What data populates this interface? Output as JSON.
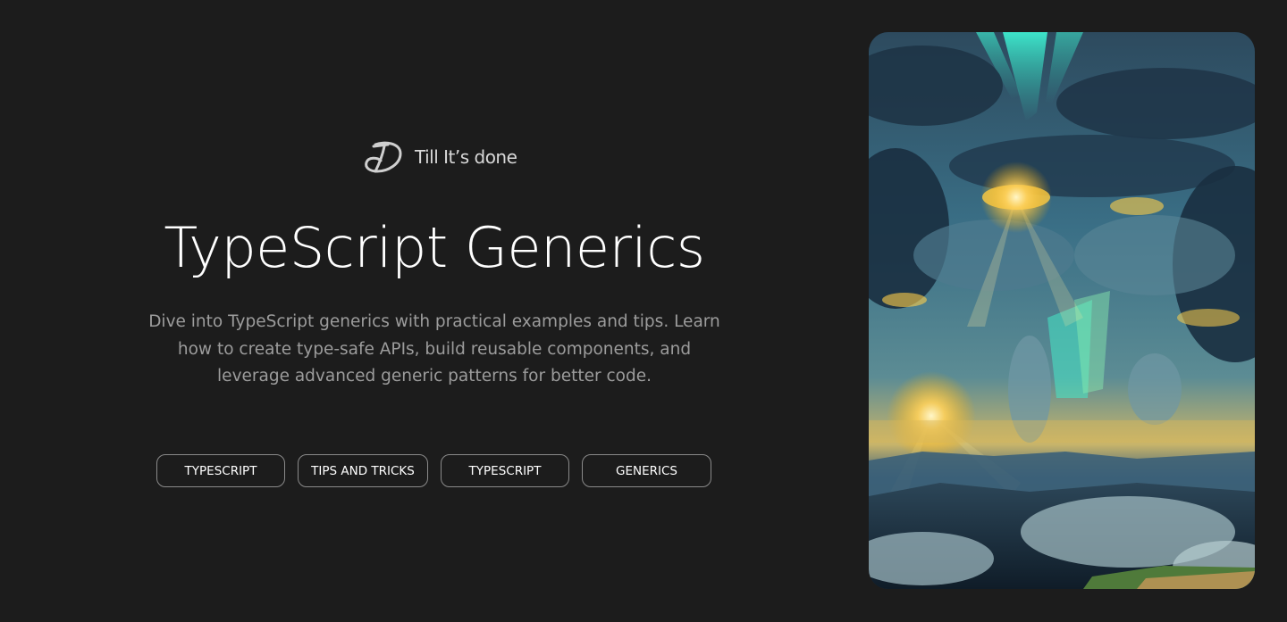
{
  "brand": {
    "name": "Till It’s done",
    "logo_icon": "till-its-done-logo-icon"
  },
  "hero": {
    "title": "TypeScript Generics",
    "description": "Dive into TypeScript generics with practical examples and tips. Learn how to create type-safe APIs, build reusable components, and leverage advanced generic patterns for better code.",
    "image": "aurora-clouds-landscape-image"
  },
  "tags": [
    {
      "label": "TYPESCRIPT"
    },
    {
      "label": "TIPS AND TRICKS"
    },
    {
      "label": "TYPESCRIPT"
    },
    {
      "label": "GENERICS"
    }
  ],
  "colors": {
    "background": "#1c1c1c",
    "title": "#ffffff",
    "description": "#9c9c9c",
    "tag_border": "#8a8a8a"
  }
}
